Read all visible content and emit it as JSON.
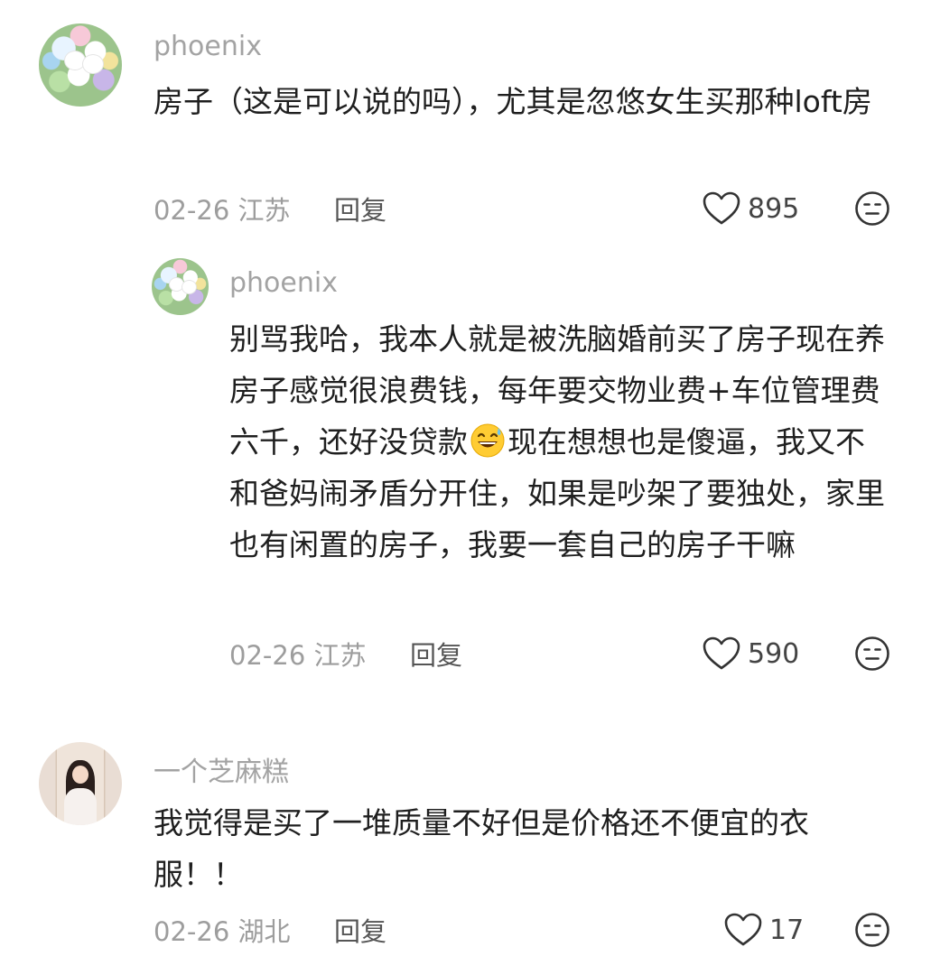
{
  "comments": [
    {
      "username": "phoenix",
      "avatar": "flower-bouquet-avatar",
      "text": "房子（这是可以说的吗），尤其是忽悠女生买那种loft房",
      "date": "02-26",
      "location": "江苏",
      "reply_label": "回复",
      "likes": "895",
      "reply": {
        "username": "phoenix",
        "avatar": "flower-bouquet-avatar",
        "text_before_emoji": "别骂我哈，我本人就是被洗脑婚前买了房子现在养房子感觉很浪费钱，每年要交物业费+车位管理费六千，还好没贷款",
        "emoji": "grinning-sweat-emoji",
        "text_after_emoji": "现在想想也是傻逼，我又不和爸妈闹矛盾分开住，如果是吵架了要独处，家里也有闲置的房子，我要一套自己的房子干嘛",
        "date": "02-26",
        "location": "江苏",
        "reply_label": "回复",
        "likes": "590"
      }
    },
    {
      "username": "一个芝麻糕",
      "avatar": "girl-photo-avatar",
      "text": "我觉得是买了一堆质量不好但是价格还不便宜的衣服！！",
      "date": "02-26",
      "location": "湖北",
      "reply_label": "回复",
      "likes": "17"
    }
  ],
  "icons": {
    "like": "heart-outline-icon",
    "dislike": "neutral-face-icon"
  },
  "colors": {
    "username": "#a3a3a3",
    "text": "#1f1f1f",
    "meta": "#9d9d9d"
  }
}
